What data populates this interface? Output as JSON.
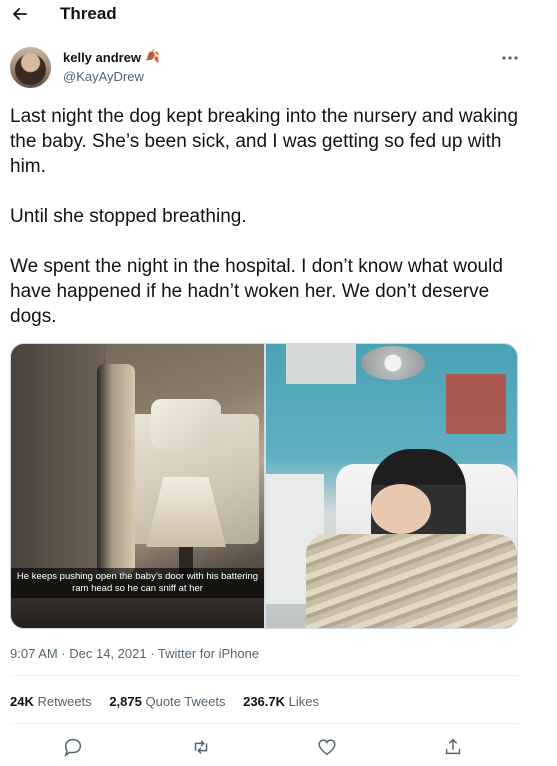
{
  "header": {
    "title": "Thread",
    "back_icon": "arrow-left-icon"
  },
  "tweet": {
    "author": {
      "display_name": "kelly andrew",
      "name_emoji": "🍂",
      "handle": "@KayAyDrew"
    },
    "paragraphs": [
      "Last night the dog kept breaking into the nursery and waking the baby. She’s been sick, and I was getting so fed up with him.",
      "Until she stopped breathing.",
      "We spent the night in the hospital. I don’t know what would have happened if he hadn’t woken her. We don’t deserve dogs."
    ],
    "media": {
      "left_caption": "He keeps pushing open the baby’s door with his battering ram head so he can sniff at her"
    },
    "timestamp": "9:07 AM · Dec 14, 2021 · Twitter for iPhone",
    "stats": {
      "retweets_count": "24K",
      "retweets_label": "Retweets",
      "quotes_count": "2,875",
      "quotes_label": "Quote Tweets",
      "likes_count": "236.7K",
      "likes_label": "Likes"
    },
    "actions": [
      "reply-icon",
      "retweet-icon",
      "like-icon",
      "share-icon"
    ]
  },
  "colors": {
    "text": "#0f1419",
    "secondary": "#536471",
    "divider": "#eff3f4"
  }
}
